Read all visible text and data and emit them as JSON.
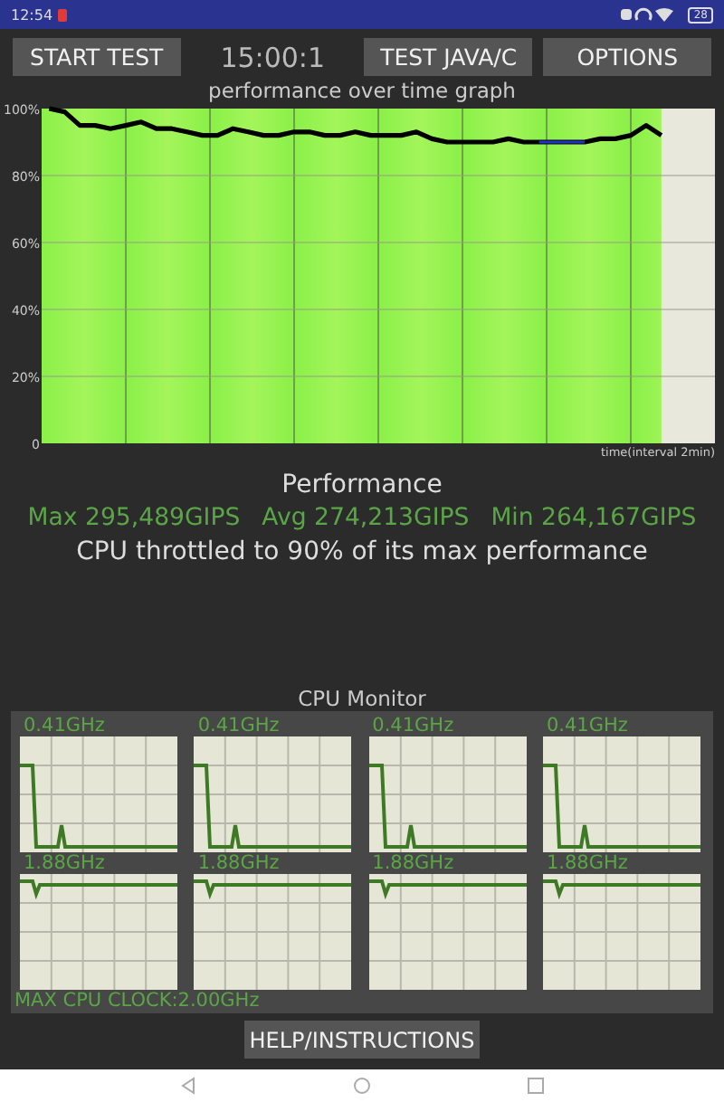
{
  "status_bar": {
    "time": "12:54",
    "battery": "28"
  },
  "toolbar": {
    "start_button": "START TEST",
    "timer": "15:00:1",
    "java_button": "TEST JAVA/C",
    "options_button": "OPTIONS"
  },
  "performance_graph": {
    "title": "performance over time graph",
    "chart_data": {
      "type": "line",
      "annotations": [
        {
          "text": "time(interval 2min)"
        }
      ],
      "grid": true,
      "categories": [
        null,
        null,
        null,
        null,
        null,
        null,
        null,
        null,
        null,
        null,
        null,
        null,
        null,
        null,
        null,
        null,
        null,
        null,
        null,
        null,
        null,
        null,
        null,
        null,
        null,
        null,
        null,
        null,
        null,
        null,
        null,
        null,
        null,
        null,
        null,
        null,
        null,
        null,
        null,
        null,
        null,
        null,
        null,
        null
      ],
      "ylim": [
        0,
        100
      ],
      "yticks": [
        {
          "value": 0,
          "label": "0"
        },
        {
          "value": 20,
          "label": "20%"
        },
        {
          "value": 40,
          "label": "40%"
        },
        {
          "value": 60,
          "label": "60%"
        },
        {
          "value": 80,
          "label": "80%"
        },
        {
          "value": 100,
          "label": "100%"
        }
      ],
      "series": [
        {
          "color": "#000000",
          "values": [
            100,
            99,
            95,
            95,
            94,
            95,
            96,
            94,
            94,
            93,
            92,
            92,
            94,
            93,
            92,
            92,
            93,
            93,
            92,
            92,
            93,
            92,
            92,
            92,
            93,
            91,
            90,
            90,
            90,
            90,
            91,
            90,
            90,
            90,
            90,
            90,
            91,
            91,
            92,
            95,
            92,
            null,
            null,
            null
          ]
        },
        {
          "color": "#2233cc",
          "values": [
            null,
            null,
            null,
            null,
            null,
            null,
            null,
            null,
            null,
            null,
            null,
            null,
            null,
            null,
            null,
            null,
            null,
            null,
            null,
            null,
            null,
            null,
            null,
            null,
            null,
            null,
            null,
            null,
            null,
            null,
            null,
            null,
            90,
            90,
            90,
            90,
            null,
            null,
            null,
            null,
            null,
            null,
            null,
            null
          ]
        }
      ]
    }
  },
  "performance": {
    "heading": "Performance",
    "max": "Max 295,489GIPS",
    "avg": "Avg 274,213GIPS",
    "min": "Min 264,167GIPS",
    "summary": "CPU throttled to 90% of its max performance"
  },
  "cpu_monitor": {
    "title": "CPU Monitor",
    "cores": [
      {
        "frequency": "0.41GHz"
      },
      {
        "frequency": "0.41GHz"
      },
      {
        "frequency": "0.41GHz"
      },
      {
        "frequency": "0.41GHz"
      },
      {
        "frequency": "1.88GHz"
      },
      {
        "frequency": "1.88GHz"
      },
      {
        "frequency": "1.88GHz"
      },
      {
        "frequency": "1.88GHz"
      }
    ],
    "max_clock": "MAX CPU CLOCK:2.00GHz"
  },
  "help_button": "HELP/INSTRUCTIONS"
}
